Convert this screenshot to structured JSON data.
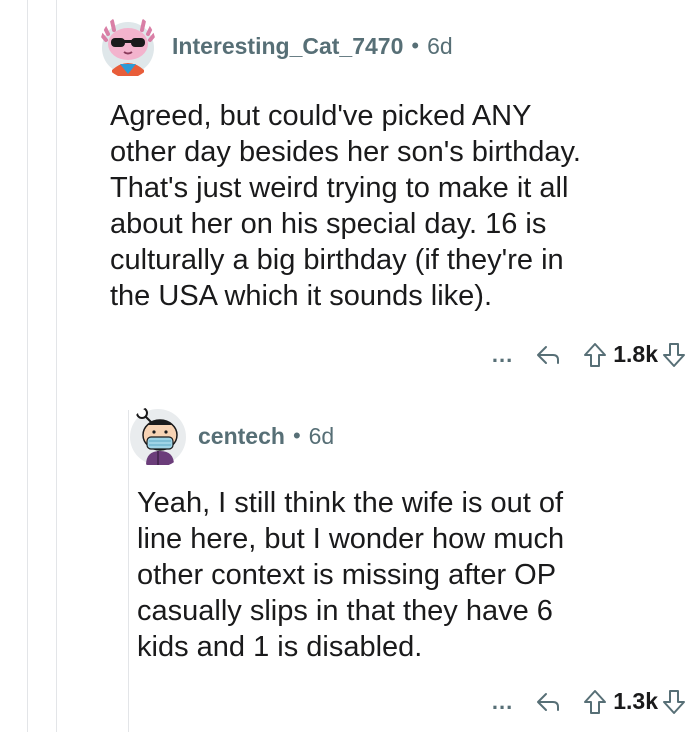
{
  "comments": [
    {
      "username": "Interesting_Cat_7470",
      "separator": "•",
      "age": "6d",
      "body": "Agreed, but could've picked ANY\nother day besides her son's birthday.\nThat's just weird trying to make it all\nabout her on his special day. 16 is\nculturally a big birthday (if they're in\nthe USA which it sounds like).",
      "more_label": "...",
      "score": "1.8k",
      "icons": [
        "avatar-axolotl",
        "reply-icon",
        "upvote-icon",
        "downvote-icon"
      ]
    },
    {
      "username": "centech",
      "separator": "•",
      "age": "6d",
      "body": "Yeah, I still think the wife is out of\nline here, but I wonder how much\nother context is missing after OP\ncasually slips in that they have 6\nkids and 1 is disabled.",
      "more_label": "...",
      "score": "1.3k",
      "icons": [
        "avatar-masked",
        "reply-icon",
        "upvote-icon",
        "downvote-icon"
      ]
    }
  ],
  "colors": {
    "meta": "#576f76",
    "text": "#1a1a1b",
    "thread_line": "#e3e5e8"
  }
}
